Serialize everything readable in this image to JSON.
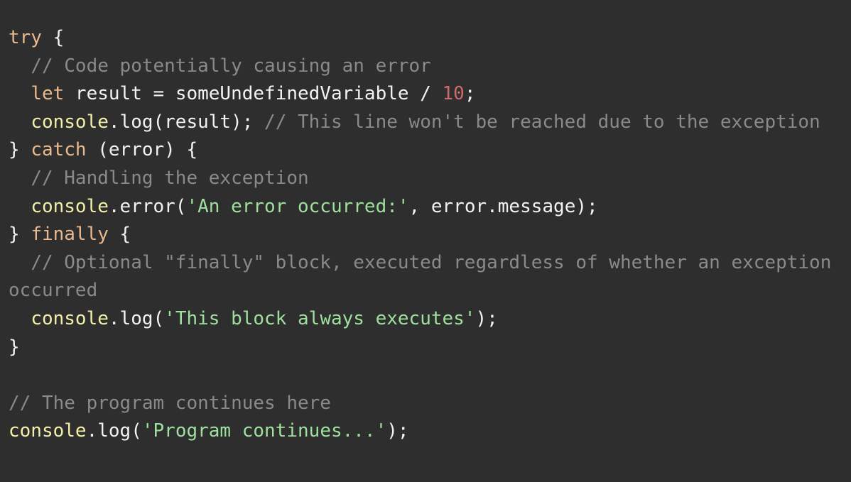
{
  "editor": {
    "language": "javascript",
    "background_color": "#2e2e2e",
    "theme_colors": {
      "keyword": "#e9b88c",
      "plain_text": "#f2f2f2",
      "comment": "#8a8a8a",
      "function_object": "#f0f0a8",
      "string": "#9ee09e",
      "number": "#cf6a6a"
    }
  },
  "code_lines": [
    {
      "index": 1,
      "text": "try {",
      "tokens": [
        {
          "t": "try",
          "c": "kw"
        },
        {
          "t": " {",
          "c": "plain"
        }
      ]
    },
    {
      "index": 2,
      "text": "  // Code potentially causing an error",
      "tokens": [
        {
          "t": "  // Code potentially causing an error",
          "c": "comment"
        }
      ]
    },
    {
      "index": 3,
      "text": "  let result = someUndefinedVariable / 10;",
      "tokens": [
        {
          "t": "  ",
          "c": "plain"
        },
        {
          "t": "let",
          "c": "kw"
        },
        {
          "t": " result = someUndefinedVariable / ",
          "c": "plain"
        },
        {
          "t": "10",
          "c": "num"
        },
        {
          "t": ";",
          "c": "plain"
        }
      ]
    },
    {
      "index": 4,
      "text": "  console.log(result); // This line won't be reached due to the exception",
      "tokens": [
        {
          "t": "  ",
          "c": "plain"
        },
        {
          "t": "console",
          "c": "fn"
        },
        {
          "t": ".log(result); ",
          "c": "plain"
        },
        {
          "t": "// This line won't be reached due to the exception",
          "c": "comment"
        }
      ]
    },
    {
      "index": 5,
      "text": "} catch (error) {",
      "tokens": [
        {
          "t": "} ",
          "c": "plain"
        },
        {
          "t": "catch",
          "c": "kw"
        },
        {
          "t": " (error) {",
          "c": "plain"
        }
      ]
    },
    {
      "index": 6,
      "text": "  // Handling the exception",
      "tokens": [
        {
          "t": "  // Handling the exception",
          "c": "comment"
        }
      ]
    },
    {
      "index": 7,
      "text": "  console.error('An error occurred:', error.message);",
      "tokens": [
        {
          "t": "  ",
          "c": "plain"
        },
        {
          "t": "console",
          "c": "fn"
        },
        {
          "t": ".error(",
          "c": "plain"
        },
        {
          "t": "'An error occurred:'",
          "c": "str"
        },
        {
          "t": ", error.message);",
          "c": "plain"
        }
      ]
    },
    {
      "index": 8,
      "text": "} finally {",
      "tokens": [
        {
          "t": "} ",
          "c": "plain"
        },
        {
          "t": "finally",
          "c": "kw"
        },
        {
          "t": " {",
          "c": "plain"
        }
      ]
    },
    {
      "index": 9,
      "text": "  // Optional \"finally\" block, executed regardless of whether an exception occurred",
      "tokens": [
        {
          "t": "  // Optional \"finally\" block, executed regardless of whether an exception occurred",
          "c": "comment"
        }
      ]
    },
    {
      "index": 10,
      "text": "  console.log('This block always executes');",
      "tokens": [
        {
          "t": "  ",
          "c": "plain"
        },
        {
          "t": "console",
          "c": "fn"
        },
        {
          "t": ".log(",
          "c": "plain"
        },
        {
          "t": "'This block always executes'",
          "c": "str"
        },
        {
          "t": ");",
          "c": "plain"
        }
      ]
    },
    {
      "index": 11,
      "text": "}",
      "tokens": [
        {
          "t": "}",
          "c": "plain"
        }
      ]
    },
    {
      "index": 12,
      "text": "",
      "tokens": []
    },
    {
      "index": 13,
      "text": "// The program continues here",
      "tokens": [
        {
          "t": "// The program continues here",
          "c": "comment"
        }
      ]
    },
    {
      "index": 14,
      "text": "console.log('Program continues...');",
      "tokens": [
        {
          "t": "console",
          "c": "fn"
        },
        {
          "t": ".log(",
          "c": "plain"
        },
        {
          "t": "'Program continues...'",
          "c": "str"
        },
        {
          "t": ");",
          "c": "plain"
        }
      ]
    }
  ]
}
